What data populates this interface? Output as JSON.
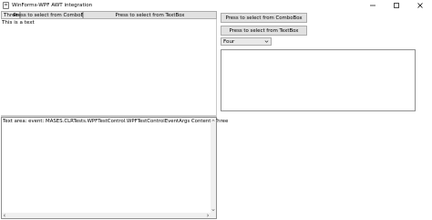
{
  "window": {
    "title": "WinForms-WPF AWT integration",
    "icons": {
      "app": "app-icon",
      "minimize": "minimize-icon",
      "maximize": "maximize-icon",
      "close": "close-icon"
    }
  },
  "left_panel": {
    "combobox": {
      "selected": "Three",
      "icon": "chevron-down-icon"
    },
    "buttons": {
      "combo_select": "Press to select from ComboBox",
      "text_select": "Press to select from TextBox"
    },
    "text_label": "This is a text",
    "textarea": {
      "content": "Text area:  event: MASES.CLRTests.WPFTestControl.WPFTestControlEventArgs Content: Three"
    }
  },
  "right_panel": {
    "buttons": {
      "combo_select": "Press to select from ComboBox",
      "text_select": "Press to select from TextBox"
    },
    "combobox": {
      "selected": "Four",
      "icon": "chevron-down-icon"
    }
  },
  "colors": {
    "button_bg": "#e1e1e1",
    "button_border": "#adadad",
    "combo_bg": "#e9e9e9",
    "border": "#8f8f8f"
  }
}
